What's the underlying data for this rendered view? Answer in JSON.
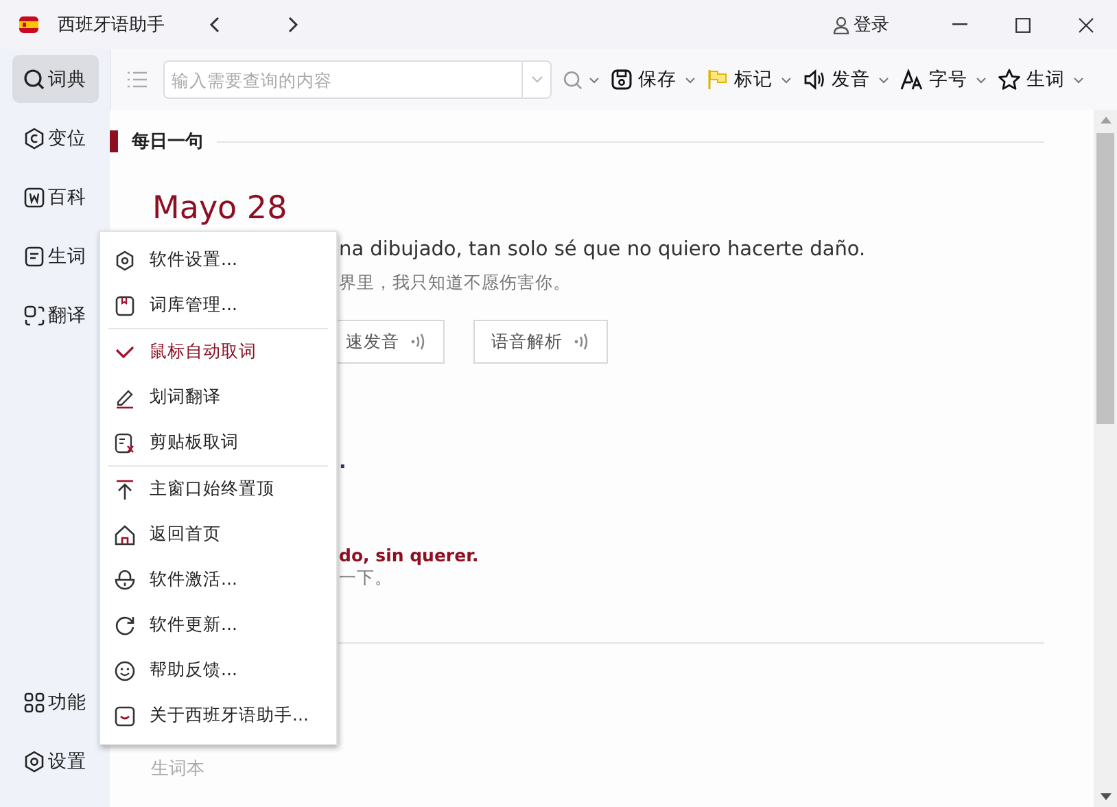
{
  "window": {
    "title": "西班牙语助手",
    "login": "登录"
  },
  "sidebar": {
    "items": [
      {
        "label": "词典",
        "selected": true
      },
      {
        "label": "变位",
        "selected": false
      },
      {
        "label": "百科",
        "selected": false
      },
      {
        "label": "生词",
        "selected": false
      },
      {
        "label": "翻译",
        "selected": false
      }
    ],
    "bottom_items": [
      {
        "label": "功能",
        "selected": false
      },
      {
        "label": "设置",
        "selected": false
      }
    ]
  },
  "toolbar": {
    "search": {
      "placeholder": "输入需要查询的内容"
    },
    "buttons": [
      "保存",
      "标记",
      "发音",
      "字号",
      "生词"
    ]
  },
  "daily": {
    "heading": "每日一句",
    "date": "Mayo 28",
    "sentence": "na dibujado, tan solo sé que no quiero hacerte daño.",
    "translation": "界里，我只知道不愿伤害你。",
    "buttons": [
      "速发音",
      "语音解析"
    ],
    "fragment_1": ".",
    "fragment_2": "do, sin querer.",
    "fragment_3": "一下。"
  },
  "section_2": {
    "heading": "生词本"
  },
  "menu": {
    "groups": [
      [
        {
          "label": "软件设置...",
          "checked": false
        },
        {
          "label": "词库管理...",
          "checked": false
        }
      ],
      [
        {
          "label": "鼠标自动取词",
          "checked": true
        },
        {
          "label": "划词翻译",
          "checked": false
        },
        {
          "label": "剪贴板取词",
          "checked": false
        }
      ],
      [
        {
          "label": "主窗口始终置顶",
          "checked": false
        },
        {
          "label": "返回首页",
          "checked": false
        },
        {
          "label": "软件激活...",
          "checked": false
        },
        {
          "label": "软件更新...",
          "checked": false
        },
        {
          "label": "帮助反馈...",
          "checked": false
        },
        {
          "label": "关于西班牙语助手...",
          "checked": false
        }
      ]
    ]
  }
}
